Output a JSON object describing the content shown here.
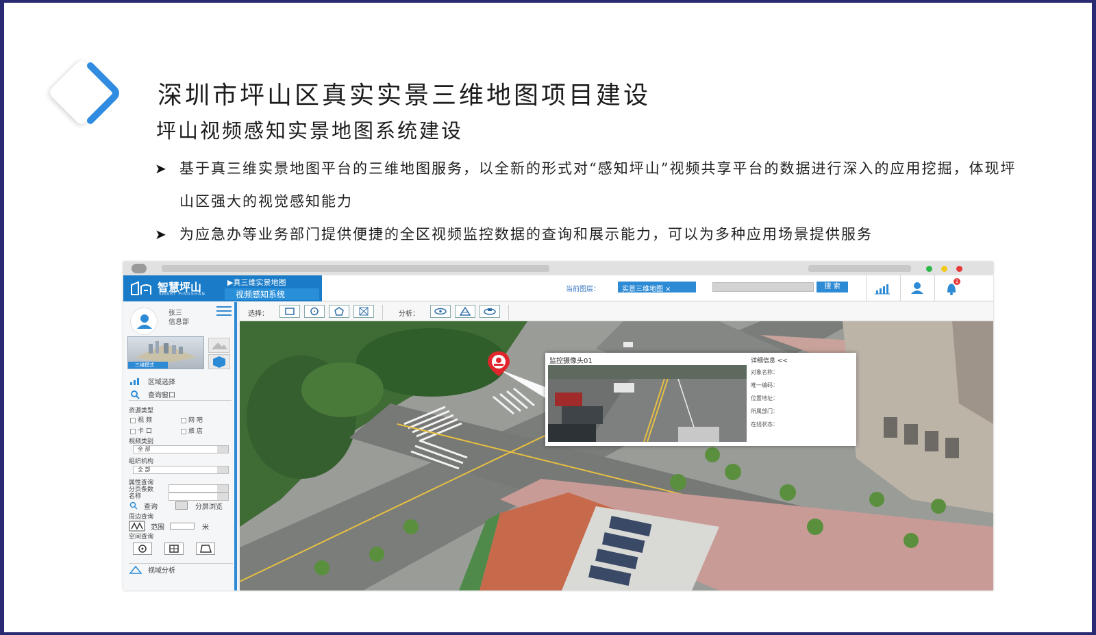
{
  "slide": {
    "title": "深圳市坪山区真实实景三维地图项目建设",
    "subtitle": "坪山视频感知实景地图系统建设",
    "bullets": [
      {
        "arrow": "➤",
        "text": "基于真三维实景地图平台的三维地图服务，以全新的形式对“感知坪山”视频共享平台的数据进行深入的应用挖掘，体现坪山区强大的视觉感知能力"
      },
      {
        "arrow": "➤",
        "text": "为应急办等业务部门提供便捷的全区视频监控数据的查询和展示能力，可以为多种应用场景提供服务"
      }
    ],
    "colors": {
      "accent": "#2d8ad4",
      "frame": "#2a2a72",
      "logo": "#2f8ce0"
    }
  },
  "app": {
    "brand_cn": "智慧坪山",
    "brand_en": "SMART PINGSHAN",
    "system_line1": "▶真三维实景地图",
    "system_line2": "视频感知系统",
    "current_layer_label": "当前图层：",
    "current_layer_value": "实景三维地图 ×",
    "search_button": "搜 索",
    "notification_count": "1",
    "icons": [
      "signal-icon",
      "user-icon",
      "bell-icon"
    ]
  },
  "sidebar": {
    "user_name": "张三",
    "user_dept": "信息部",
    "mode_tag": "三维模式",
    "region_select": "区域选择",
    "query_window": "查询窗口",
    "resource_type": "资源类型",
    "res_video": "视 频",
    "res_netbar": "网 吧",
    "res_checkpoint": "卡 口",
    "res_hotel": "旅 店",
    "video_category": "视频类别",
    "video_category_value": "全 部",
    "org": "组织机构",
    "org_value": "全 部",
    "attr_query": "属性查询",
    "page_size": "分页条数",
    "name": "名称",
    "query_btn": "查询",
    "split_view": "分屏浏览",
    "nearby_query": "周边查询",
    "range": "范围",
    "meter": "米",
    "spatial_query": "空间查询",
    "view_analysis": "视域分析"
  },
  "toolbar": {
    "select_label": "选择：",
    "analysis_label": "分析："
  },
  "map": {
    "camera_title": "监控摄像头01",
    "detail_header": "详细信息 <<",
    "detail_fields": [
      "对象名称：",
      "唯一编码：",
      "位置地址：",
      "所属部门：",
      "在线状态："
    ]
  }
}
